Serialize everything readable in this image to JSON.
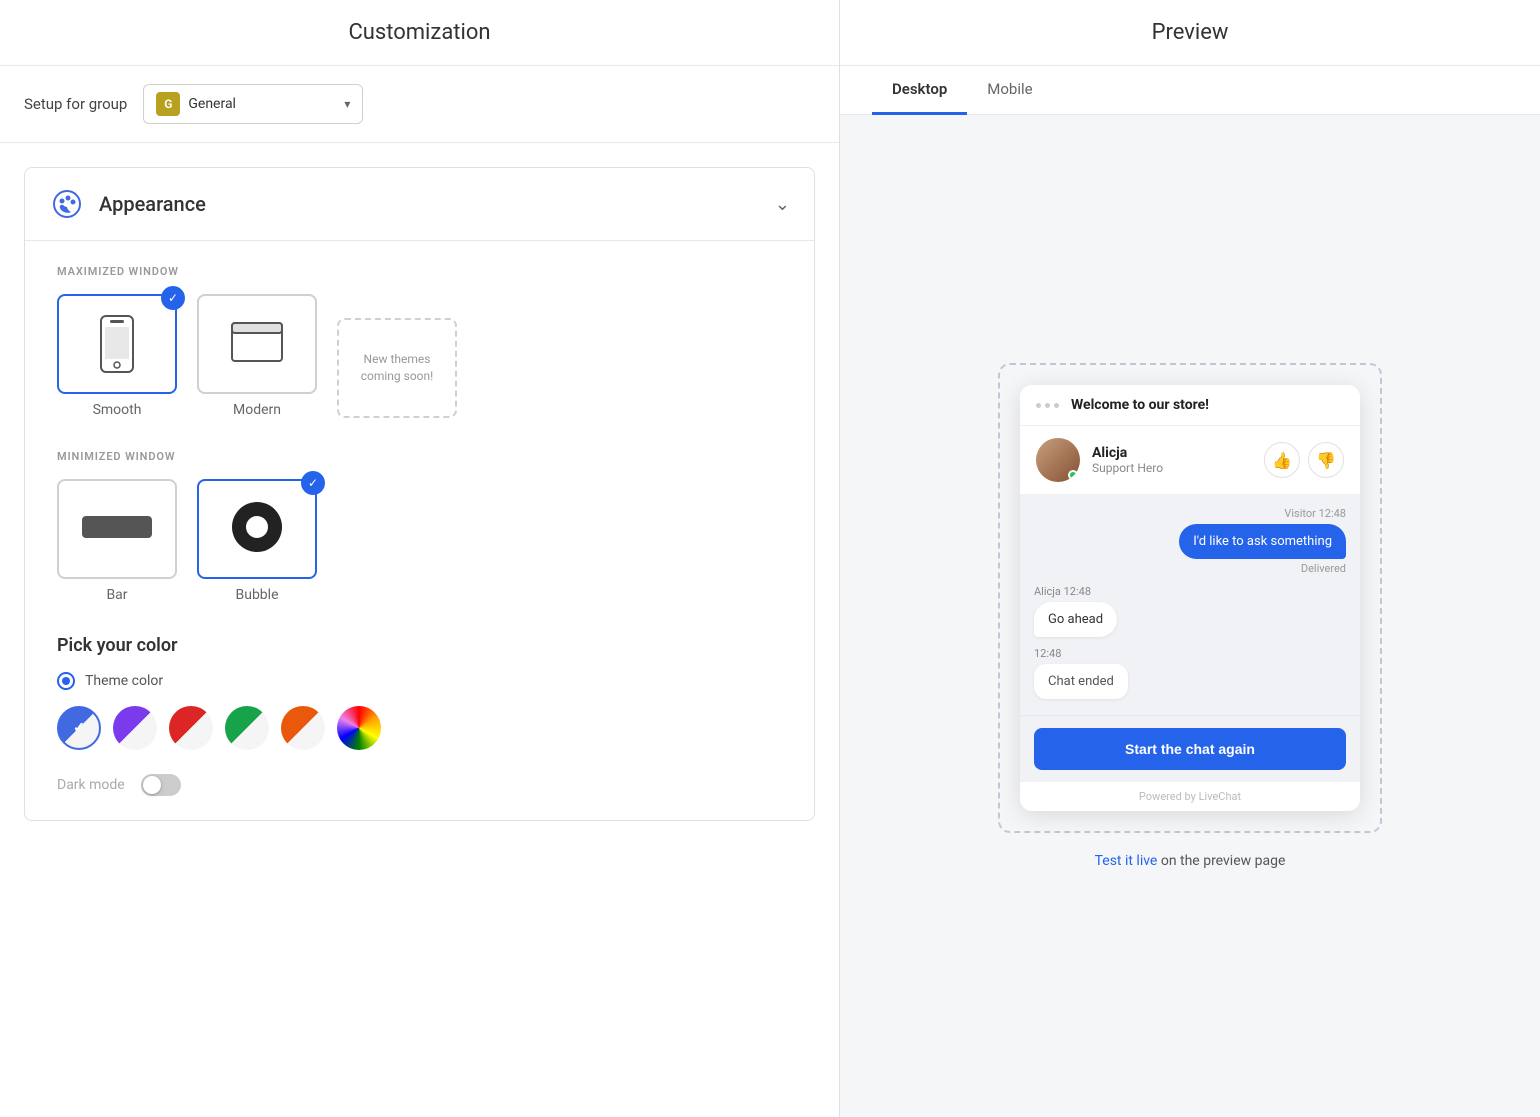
{
  "page": {
    "left_title": "Customization",
    "right_title": "Preview"
  },
  "setup": {
    "label": "Setup for group",
    "group": {
      "initial": "G",
      "name": "General"
    }
  },
  "appearance": {
    "title": "Appearance",
    "maximized_label": "MAXIMIZED WINDOW",
    "minimized_label": "MINIMIZED WINDOW",
    "themes": [
      {
        "id": "smooth",
        "label": "Smooth",
        "selected": true
      },
      {
        "id": "modern",
        "label": "Modern",
        "selected": false
      },
      {
        "id": "new",
        "label": "New themes coming soon!",
        "selected": false,
        "dashed": true
      }
    ],
    "minimized_themes": [
      {
        "id": "bar",
        "label": "Bar",
        "selected": false
      },
      {
        "id": "bubble",
        "label": "Bubble",
        "selected": true
      }
    ],
    "color_section": {
      "title": "Pick your color",
      "option_label": "Theme color",
      "swatches": [
        {
          "id": "blue",
          "color": "#4169e1",
          "selected": true
        },
        {
          "id": "purple",
          "color": "#7c3aed",
          "selected": false
        },
        {
          "id": "red",
          "color": "#dc2626",
          "selected": false
        },
        {
          "id": "green",
          "color": "#16a34a",
          "selected": false
        },
        {
          "id": "orange",
          "color": "#ea580c",
          "selected": false
        },
        {
          "id": "rainbow",
          "color": "rainbow",
          "selected": false
        }
      ]
    },
    "dark_mode_label": "Dark mode"
  },
  "preview": {
    "tabs": [
      {
        "id": "desktop",
        "label": "Desktop",
        "active": true
      },
      {
        "id": "mobile",
        "label": "Mobile",
        "active": false
      }
    ],
    "chat": {
      "welcome": "Welcome to our store!",
      "agent_name": "Alicja",
      "agent_role": "Support Hero",
      "messages": [
        {
          "type": "visitor",
          "time": "Visitor 12:48",
          "text": "I'd like to ask something",
          "status": "Delivered"
        },
        {
          "type": "agent",
          "time": "Alicja 12:48",
          "text": "Go ahead"
        },
        {
          "type": "system",
          "time": "12:48",
          "text": "Chat ended"
        }
      ],
      "cta_button": "Start the chat again",
      "footer": "Powered by LiveChat"
    },
    "test_link_pre": "Test it live",
    "test_link_post": " on the preview page"
  }
}
